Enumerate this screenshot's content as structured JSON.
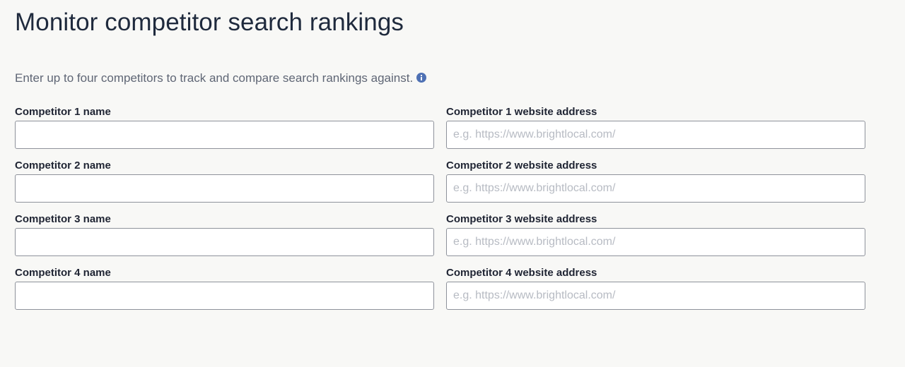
{
  "page": {
    "title": "Monitor competitor search rankings",
    "intro": "Enter up to four competitors to track and compare search rankings against."
  },
  "icons": {
    "info": "info-icon",
    "info_color": "#4f71b4"
  },
  "competitors": [
    {
      "name_label": "Competitor 1 name",
      "name_value": "",
      "url_label": "Competitor 1 website address",
      "url_value": "",
      "url_placeholder": "e.g. https://www.brightlocal.com/"
    },
    {
      "name_label": "Competitor 2 name",
      "name_value": "",
      "url_label": "Competitor 2 website address",
      "url_value": "",
      "url_placeholder": "e.g. https://www.brightlocal.com/"
    },
    {
      "name_label": "Competitor 3 name",
      "name_value": "",
      "url_label": "Competitor 3 website address",
      "url_value": "",
      "url_placeholder": "e.g. https://www.brightlocal.com/"
    },
    {
      "name_label": "Competitor 4 name",
      "name_value": "",
      "url_label": "Competitor 4 website address",
      "url_value": "",
      "url_placeholder": "e.g. https://www.brightlocal.com/"
    }
  ]
}
